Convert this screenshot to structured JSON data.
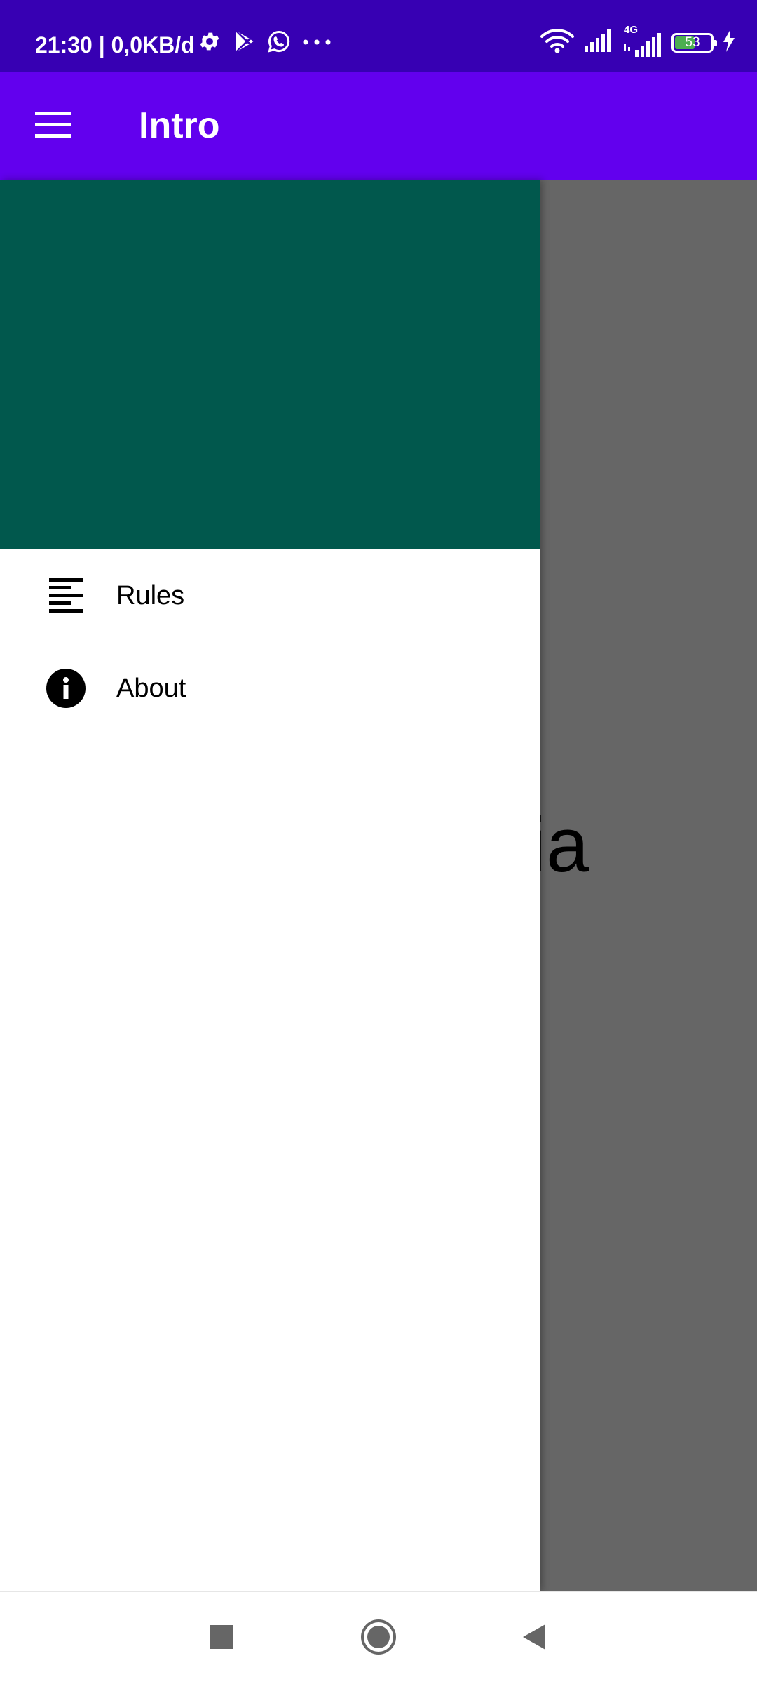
{
  "status_bar": {
    "time_text": "21:30 | 0,0KB/d",
    "network_label": "4G",
    "battery_level": "53",
    "icons_left": [
      "settings-icon",
      "play-store-icon",
      "whatsapp-icon",
      "more-icon"
    ],
    "icons_right": [
      "wifi-icon",
      "signal-icon",
      "signal-4g-icon",
      "battery-icon",
      "charging-icon"
    ]
  },
  "app_bar": {
    "title": "Intro",
    "menu_icon": "hamburger-menu-icon"
  },
  "content": {
    "partial_text": "via"
  },
  "drawer": {
    "header_color": "#01584d",
    "items": [
      {
        "label": "Rules",
        "icon": "rules-icon"
      },
      {
        "label": "About",
        "icon": "info-icon"
      }
    ]
  },
  "nav_bar": {
    "buttons": [
      "recents-button",
      "home-button",
      "back-button"
    ]
  },
  "colors": {
    "status_bar": "#3700b3",
    "app_bar": "#6200ee",
    "drawer_header": "#01584d",
    "scrim": "#666666"
  }
}
